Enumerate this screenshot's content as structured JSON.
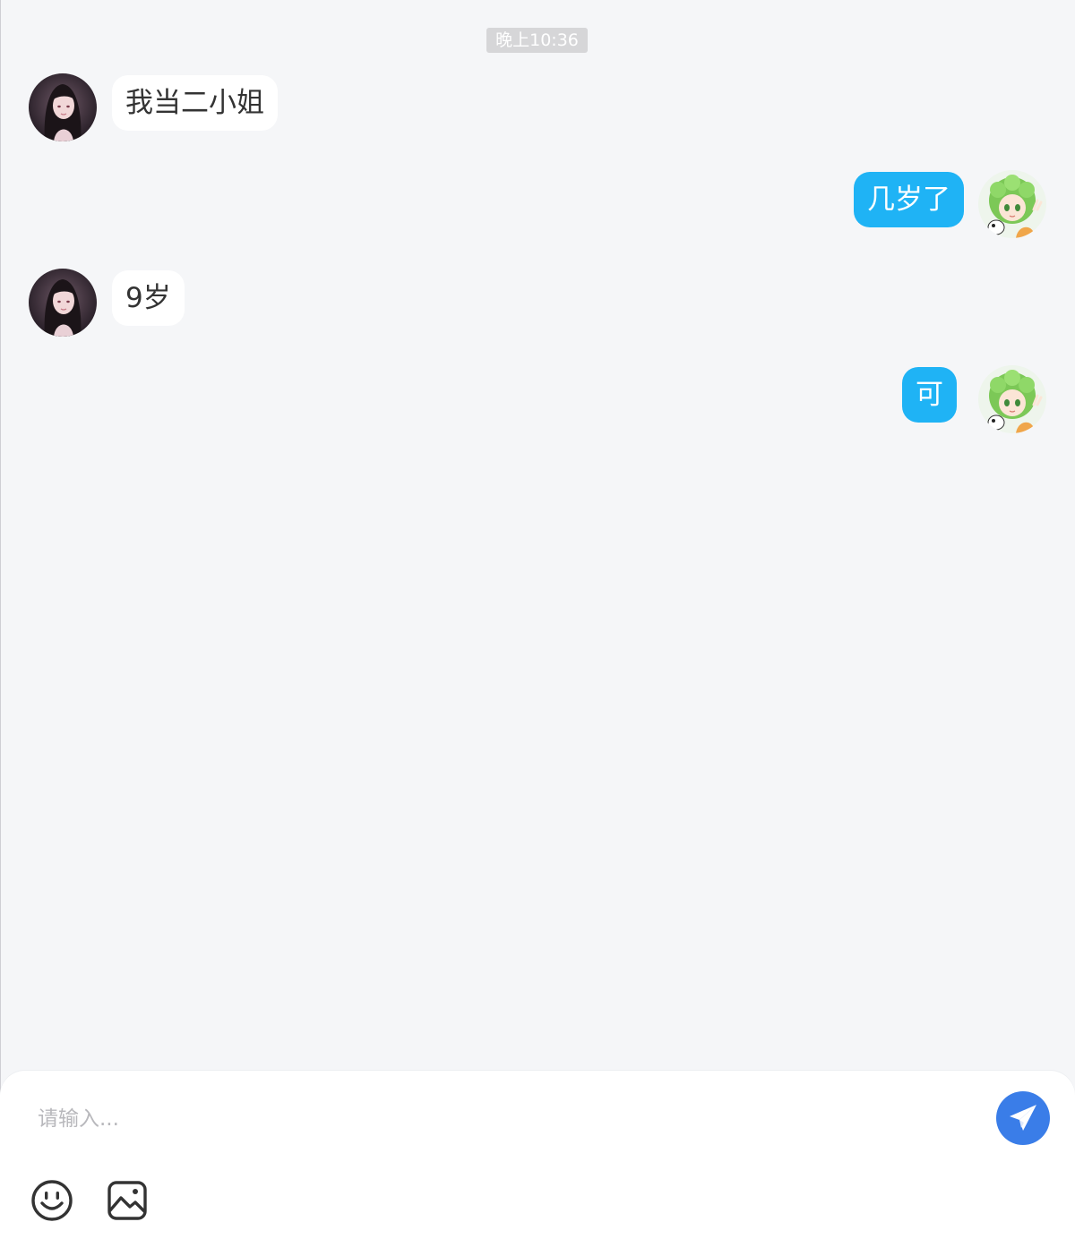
{
  "timestamp": "晚上10:36",
  "messages": [
    {
      "side": "left",
      "avatar": "long-dark-hair-girl-avatar",
      "text": "我当二小姐"
    },
    {
      "side": "right",
      "avatar": "green-hair-girl-avatar",
      "text": "几岁了"
    },
    {
      "side": "left",
      "avatar": "long-dark-hair-girl-avatar",
      "text": "9岁"
    },
    {
      "side": "right",
      "avatar": "green-hair-girl-avatar",
      "text": "可"
    }
  ],
  "composer": {
    "placeholder": "请输入...",
    "value": "",
    "send_icon": "send-paper-plane-icon",
    "tools": [
      "emoji-icon",
      "image-icon"
    ]
  },
  "colors": {
    "background": "#f5f6f8",
    "outgoing_bubble": "#1fb3f5",
    "incoming_bubble": "#ffffff",
    "send_button": "#3a7de8",
    "timestamp_bg": "#d6d6d8"
  }
}
